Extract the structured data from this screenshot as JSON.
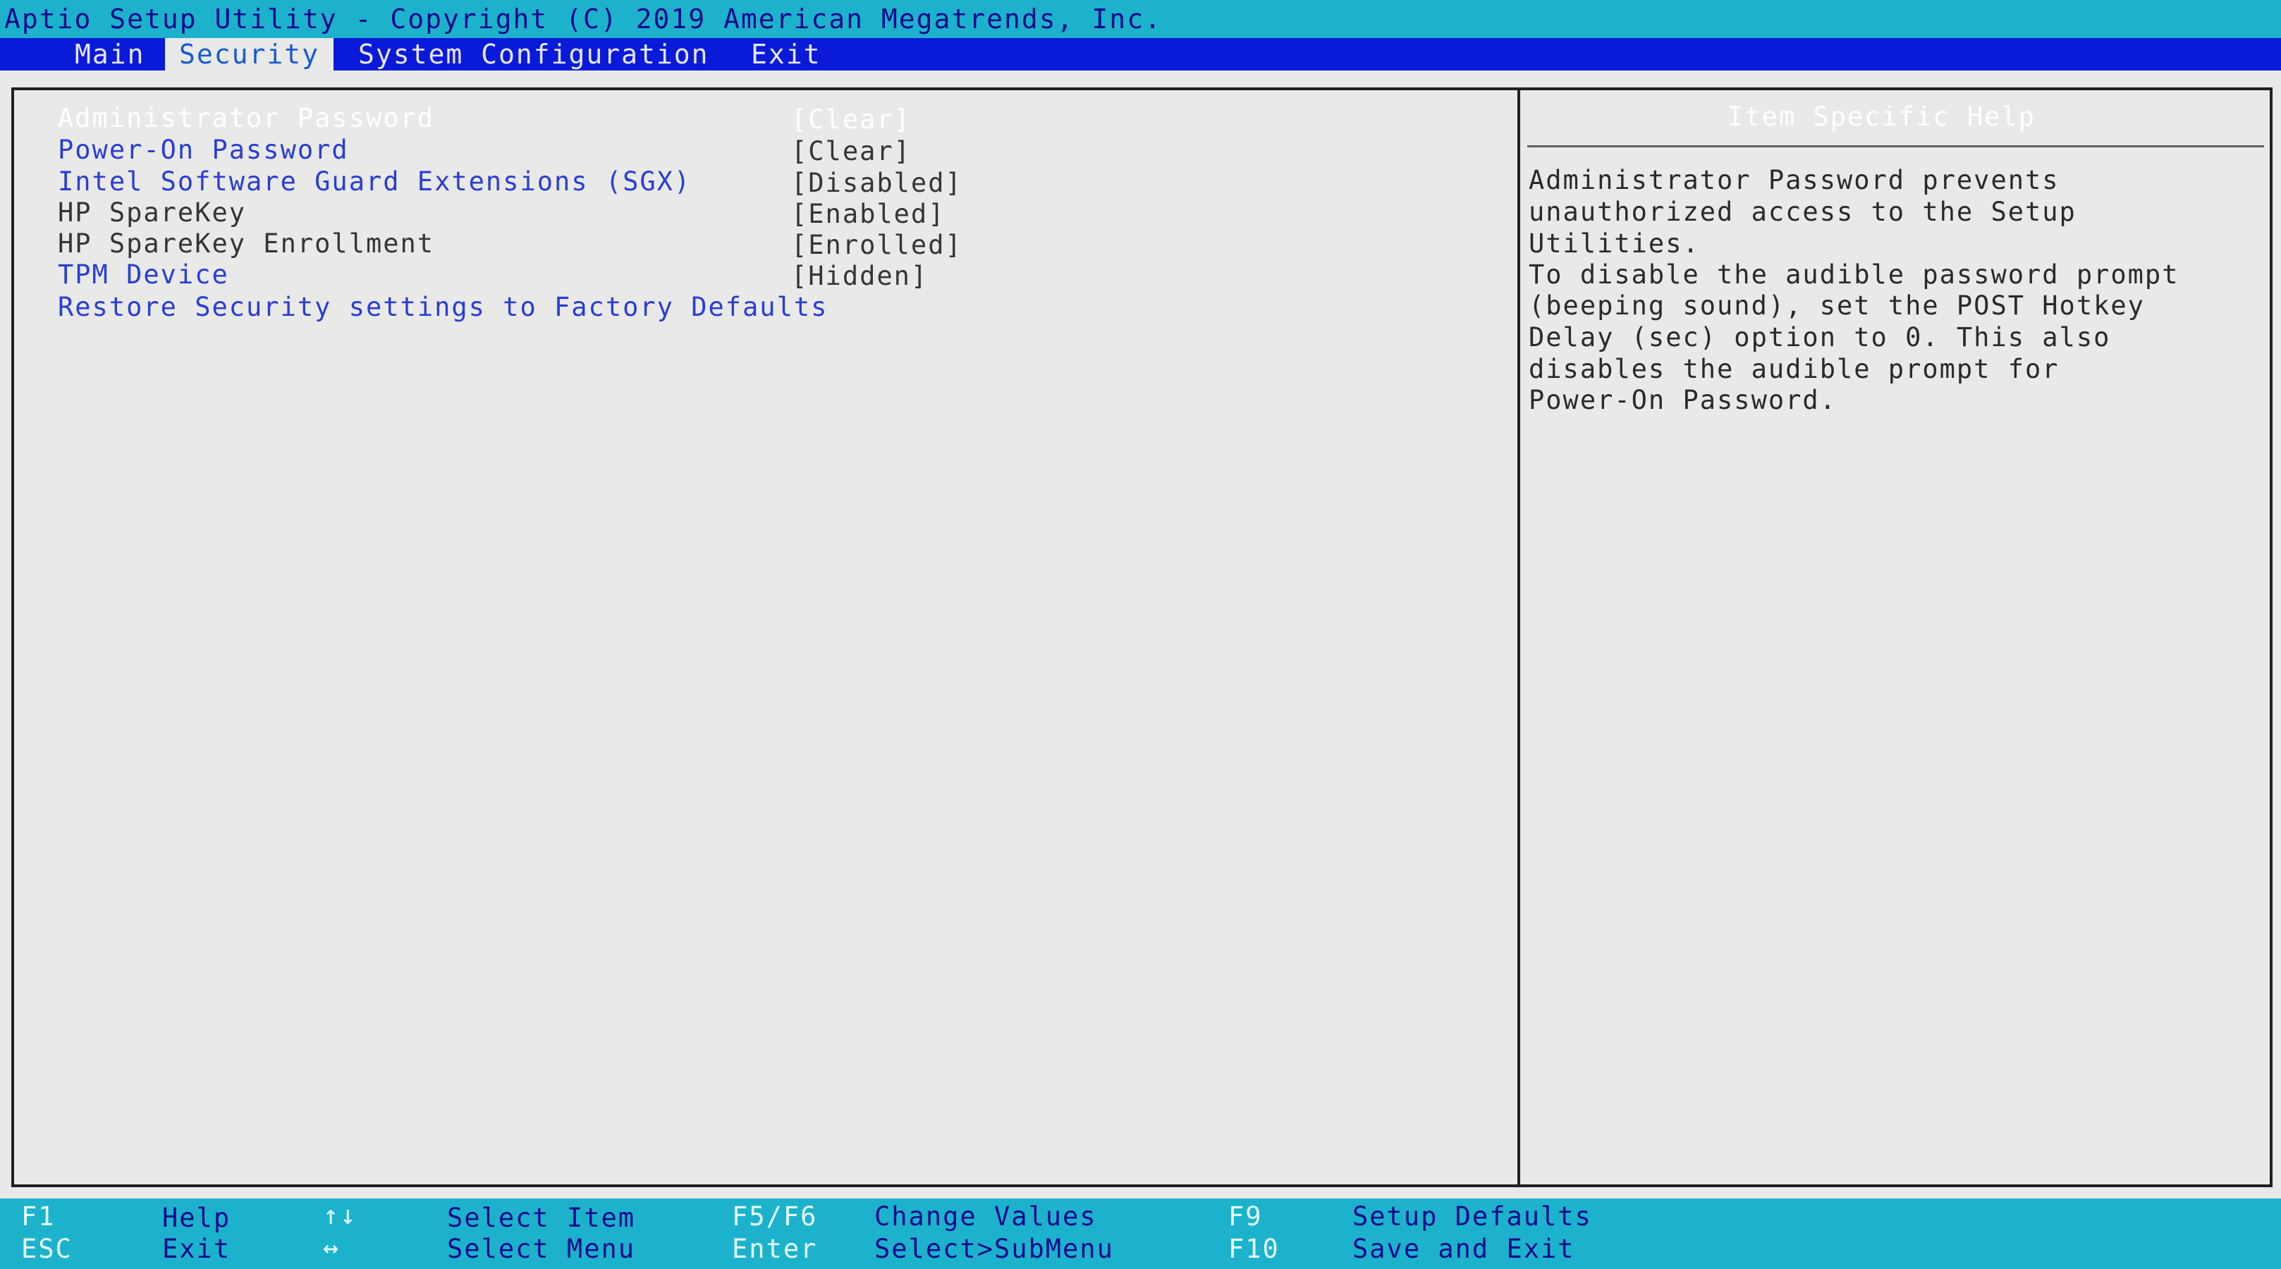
{
  "header": {
    "title": "Aptio Setup Utility - Copyright (C) 2019 American Megatrends, Inc."
  },
  "menu": {
    "tabs": [
      {
        "label": "Main"
      },
      {
        "label": "Security"
      },
      {
        "label": "System Configuration"
      },
      {
        "label": "Exit"
      }
    ],
    "active": "Security"
  },
  "settings": {
    "items": [
      {
        "label": "Administrator Password",
        "value": "[Clear]"
      },
      {
        "label": "Power-On Password",
        "value": "[Clear]"
      },
      {
        "label": "Intel Software Guard Extensions (SGX)",
        "value": "[Disabled]"
      },
      {
        "label": "HP SpareKey",
        "value": "[Enabled]"
      },
      {
        "label": "HP SpareKey Enrollment",
        "value": "[Enrolled]"
      },
      {
        "label": "TPM Device",
        "value": "[Hidden]"
      },
      {
        "label": "Restore Security settings to Factory Defaults",
        "value": ""
      }
    ],
    "selected_index": 0
  },
  "help": {
    "title": "Item Specific Help",
    "lines": [
      "Administrator Password prevents",
      "unauthorized access to the Setup",
      "Utilities.",
      "To disable the audible password prompt",
      "(beeping sound), set the POST Hotkey",
      "Delay (sec) option to 0. This also",
      "disables the audible prompt for",
      "Power-On Password."
    ]
  },
  "footer": {
    "row1": {
      "k1": "F1",
      "d1": "Help",
      "k2": "↑↓",
      "d2": "Select Item",
      "k3": "F5/F6",
      "d3": "Change Values",
      "k4": "F9",
      "d4": "Setup Defaults"
    },
    "row2": {
      "k1": "ESC",
      "d1": "Exit",
      "k2": "↔",
      "d2": "Select Menu",
      "k3": "Enter",
      "d3": "Select>SubMenu",
      "k4": "F10",
      "d4": "Save and Exit"
    }
  },
  "colors": {
    "title_bar": "#1cb2cc",
    "menu_bar": "#0a1ad9",
    "background": "#e9e9e7",
    "link_text": "#2a3dd6",
    "selected_text": "#ffffff"
  }
}
